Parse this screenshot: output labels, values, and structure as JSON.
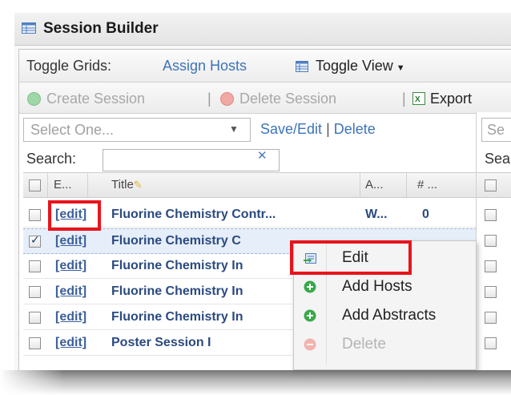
{
  "window": {
    "title": "Session Builder"
  },
  "toolbar": {
    "toggle_grids_label": "Toggle Grids:",
    "assign_hosts": "Assign Hosts",
    "toggle_view": "Toggle View",
    "create_session": "Create Session",
    "delete_session": "Delete Session",
    "separator": "|",
    "export": "Export"
  },
  "left_grid": {
    "select_placeholder": "Select One...",
    "save_edit": "Save/Edit",
    "delete": "Delete",
    "search_label": "Search:",
    "search_value": "",
    "clear_glyph": "✕",
    "columns": [
      "E...",
      "Title",
      "A...",
      "# ..."
    ],
    "rows": [
      {
        "edit": "[edit]",
        "title": "Fluorine Chemistry Contr...",
        "a": "W...",
        "n": "0",
        "checked": false
      },
      {
        "edit": "[edit]",
        "title": "Fluorine Chemistry C",
        "a": "",
        "n": "",
        "checked": true
      },
      {
        "edit": "[edit]",
        "title": "Fluorine Chemistry In",
        "a": "",
        "n": "",
        "checked": false
      },
      {
        "edit": "[edit]",
        "title": "Fluorine Chemistry In",
        "a": "",
        "n": "",
        "checked": false
      },
      {
        "edit": "[edit]",
        "title": "Fluorine Chemistry In",
        "a": "",
        "n": "",
        "checked": false
      },
      {
        "edit": "[edit]",
        "title": "Poster Session I",
        "a": "",
        "n": "",
        "checked": false
      }
    ]
  },
  "right_grid": {
    "select_placeholder": "Se",
    "search_label": "Sea"
  },
  "context_menu": {
    "items": [
      {
        "label": "Edit",
        "icon": "edit-icon",
        "disabled": false
      },
      {
        "label": "Add Hosts",
        "icon": "add-icon",
        "disabled": false
      },
      {
        "label": "Add Abstracts",
        "icon": "add-icon",
        "disabled": false
      },
      {
        "label": "Delete",
        "icon": "delete-icon",
        "disabled": true
      }
    ]
  },
  "colors": {
    "link": "#3c74b9",
    "highlight_box": "#e8141c",
    "add_green": "#3aa84a",
    "delete_red": "#e0564f"
  }
}
